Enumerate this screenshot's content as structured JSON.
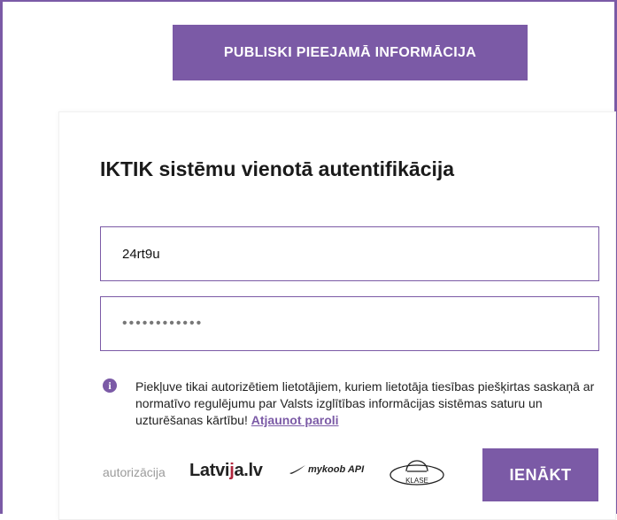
{
  "public_info_button": "PUBLISKI PIEEJAMĀ INFORMĀCIJA",
  "login_form": {
    "title": "IKTIK sistēmu vienotā autentifikācija",
    "username_value": "24rt9u",
    "password_display": "••••••••••••",
    "notice_text": "Piekļuve tikai autorizētiem lietotājiem, kuriem lietotāja tiesības piešķirtas saskaņā ar normatīvo regulējumu par Valsts izglītības informācijas sistēmas saturu un uzturēšanas kārtību! ",
    "reset_password_link": "Atjaunot paroli",
    "auth_label": "autorizācija",
    "login_button": "IENĀKT"
  },
  "providers": {
    "latvija_pre": "Latvi",
    "latvija_j": "j",
    "latvija_post": "a.lv",
    "mykoob": "mykoob API",
    "klase": "KLASE"
  },
  "colors": {
    "accent": "#7b5aa6",
    "latvija_red": "#b0263d"
  },
  "icons": [
    "info-icon",
    "mykoob-swoosh-icon"
  ]
}
